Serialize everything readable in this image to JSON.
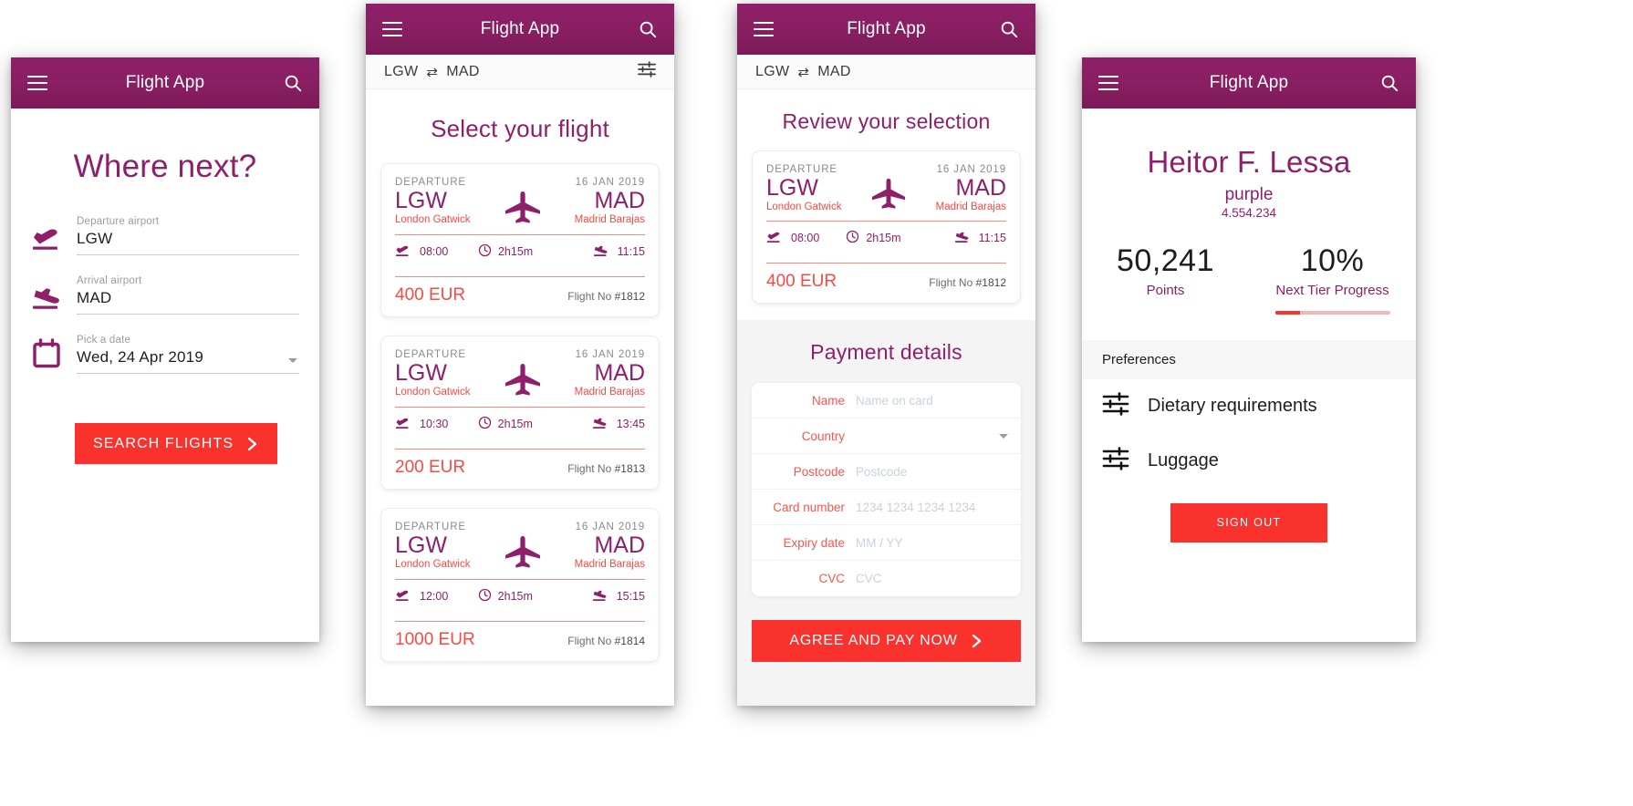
{
  "app": {
    "title": "Flight App",
    "brand_purple": "#8e1f6b",
    "accent_red": "#f9322d",
    "city_red": "#f74a43"
  },
  "route_bar": {
    "from": "LGW",
    "swap": "⇄",
    "to": "MAD"
  },
  "screen1": {
    "heading": "Where next?",
    "fields": [
      {
        "label": "Departure airport",
        "value": "LGW",
        "icon": "takeoff-icon"
      },
      {
        "label": "Arrival airport",
        "value": "MAD",
        "icon": "landing-icon"
      },
      {
        "label": "Pick a date",
        "value": "Wed, 24 Apr 2019",
        "icon": "calendar-icon"
      }
    ],
    "cta": "SEARCH FLIGHTS"
  },
  "screen2": {
    "heading": "Select your flight",
    "flights": [
      {
        "kicker": "DEPARTURE",
        "date": "16 JAN 2019",
        "from_code": "LGW",
        "from_city": "London Gatwick",
        "to_code": "MAD",
        "to_city": "Madrid Barajas",
        "depart_time": "08:00",
        "duration": "2h15m",
        "arrive_time": "11:15",
        "price": "400 EUR",
        "flight_no_label": "Flight No",
        "flight_no": "#1812"
      },
      {
        "kicker": "DEPARTURE",
        "date": "16 JAN 2019",
        "from_code": "LGW",
        "from_city": "London Gatwick",
        "to_code": "MAD",
        "to_city": "Madrid Barajas",
        "depart_time": "10:30",
        "duration": "2h15m",
        "arrive_time": "13:45",
        "price": "200 EUR",
        "flight_no_label": "Flight No",
        "flight_no": "#1813"
      },
      {
        "kicker": "DEPARTURE",
        "date": "16 JAN 2019",
        "from_code": "LGW",
        "from_city": "London Gatwick",
        "to_code": "MAD",
        "to_city": "Madrid Barajas",
        "depart_time": "12:00",
        "duration": "2h15m",
        "arrive_time": "15:15",
        "price": "1000 EUR",
        "flight_no_label": "Flight No",
        "flight_no": "#1814"
      }
    ]
  },
  "screen3": {
    "heading": "Review your selection",
    "flight": {
      "kicker": "DEPARTURE",
      "date": "16 JAN 2019",
      "from_code": "LGW",
      "from_city": "London Gatwick",
      "to_code": "MAD",
      "to_city": "Madrid Barajas",
      "depart_time": "08:00",
      "duration": "2h15m",
      "arrive_time": "11:15",
      "price": "400 EUR",
      "flight_no_label": "Flight No",
      "flight_no": "#1812"
    },
    "payment_heading": "Payment details",
    "fields": [
      {
        "label": "Name",
        "placeholder": "Name on card"
      },
      {
        "label": "Country",
        "placeholder": ""
      },
      {
        "label": "Postcode",
        "placeholder": "Postcode"
      },
      {
        "label": "Card number",
        "placeholder": "1234 1234 1234 1234"
      },
      {
        "label": "Expiry date",
        "placeholder": "MM / YY"
      },
      {
        "label": "CVC",
        "placeholder": "CVC"
      }
    ],
    "cta": "AGREE AND PAY NOW"
  },
  "screen4": {
    "name": "Heitor F. Lessa",
    "tier": "purple",
    "version": "4.554.234",
    "stats": [
      {
        "value": "50,241",
        "caption": "Points"
      },
      {
        "value": "10%",
        "caption": "Next Tier Progress"
      }
    ],
    "preferences_heading": "Preferences",
    "preferences": [
      {
        "label": "Dietary requirements",
        "icon": "tune-icon"
      },
      {
        "label": "Luggage",
        "icon": "tune-icon"
      }
    ],
    "cta": "SIGN OUT"
  }
}
